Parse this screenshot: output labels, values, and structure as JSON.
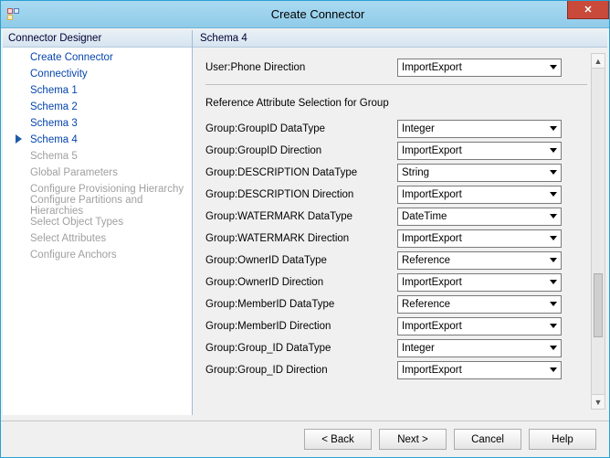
{
  "window": {
    "title": "Create Connector"
  },
  "sidebar": {
    "header": "Connector Designer",
    "items": [
      {
        "label": "Create Connector",
        "state": "link",
        "indent": 1
      },
      {
        "label": "Connectivity",
        "state": "link",
        "indent": 1
      },
      {
        "label": "Schema 1",
        "state": "link",
        "indent": 1
      },
      {
        "label": "Schema 2",
        "state": "link",
        "indent": 1
      },
      {
        "label": "Schema 3",
        "state": "link",
        "indent": 1
      },
      {
        "label": "Schema 4",
        "state": "current",
        "indent": 1
      },
      {
        "label": "Schema 5",
        "state": "disabled",
        "indent": 1
      },
      {
        "label": "Global Parameters",
        "state": "disabled",
        "indent": 1
      },
      {
        "label": "Configure Provisioning Hierarchy",
        "state": "disabled",
        "indent": 1
      },
      {
        "label": "Configure Partitions and Hierarchies",
        "state": "disabled",
        "indent": 1
      },
      {
        "label": "Select Object Types",
        "state": "disabled",
        "indent": 1
      },
      {
        "label": "Select Attributes",
        "state": "disabled",
        "indent": 1
      },
      {
        "label": "Configure Anchors",
        "state": "disabled",
        "indent": 1
      }
    ]
  },
  "main": {
    "header": "Schema 4",
    "top_row": {
      "label": "User:Phone Direction",
      "value": "ImportExport"
    },
    "section_title": "Reference Attribute Selection for Group",
    "rows": [
      {
        "label": "Group:GroupID DataType",
        "value": "Integer"
      },
      {
        "label": "Group:GroupID Direction",
        "value": "ImportExport"
      },
      {
        "label": "Group:DESCRIPTION DataType",
        "value": "String"
      },
      {
        "label": "Group:DESCRIPTION Direction",
        "value": "ImportExport"
      },
      {
        "label": "Group:WATERMARK DataType",
        "value": "DateTime"
      },
      {
        "label": "Group:WATERMARK Direction",
        "value": "ImportExport"
      },
      {
        "label": "Group:OwnerID DataType",
        "value": "Reference"
      },
      {
        "label": "Group:OwnerID Direction",
        "value": "ImportExport"
      },
      {
        "label": "Group:MemberID DataType",
        "value": "Reference"
      },
      {
        "label": "Group:MemberID Direction",
        "value": "ImportExport"
      },
      {
        "label": "Group:Group_ID DataType",
        "value": "Integer"
      },
      {
        "label": "Group:Group_ID Direction",
        "value": "ImportExport"
      }
    ]
  },
  "footer": {
    "back": "<  Back",
    "next": "Next  >",
    "cancel": "Cancel",
    "help": "Help"
  }
}
